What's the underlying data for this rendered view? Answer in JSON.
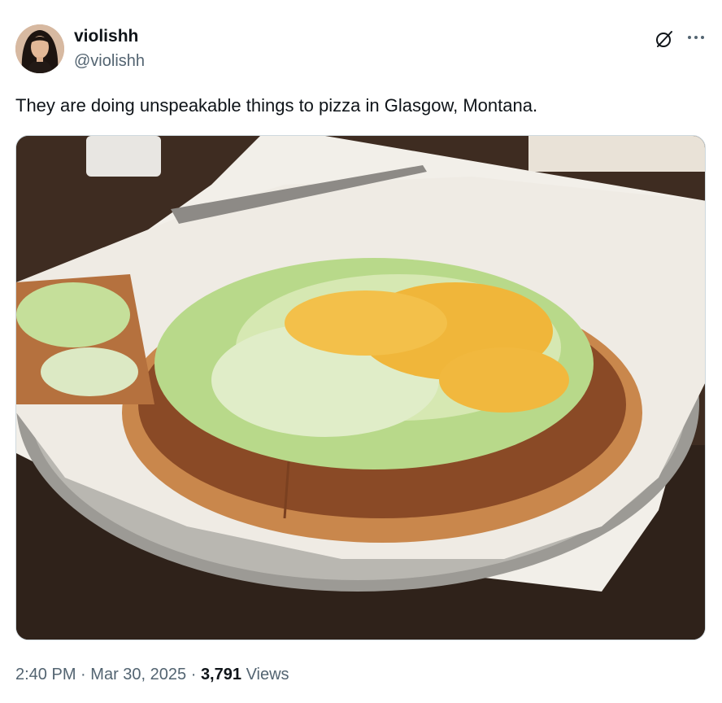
{
  "tweet": {
    "display_name": "violishh",
    "handle": "@violishh",
    "text": "They are doing unspeakable things to pizza in Glasgow, Montana.",
    "time": "2:40 PM",
    "separator": "·",
    "date": "Mar 30, 2025",
    "views_count": "3,791",
    "views_label": "Views"
  },
  "icons": {
    "grok": "grok-icon",
    "more": "more-icon"
  },
  "colors": {
    "text_primary": "#0f1419",
    "text_secondary": "#536471",
    "border": "#cfd9de"
  }
}
